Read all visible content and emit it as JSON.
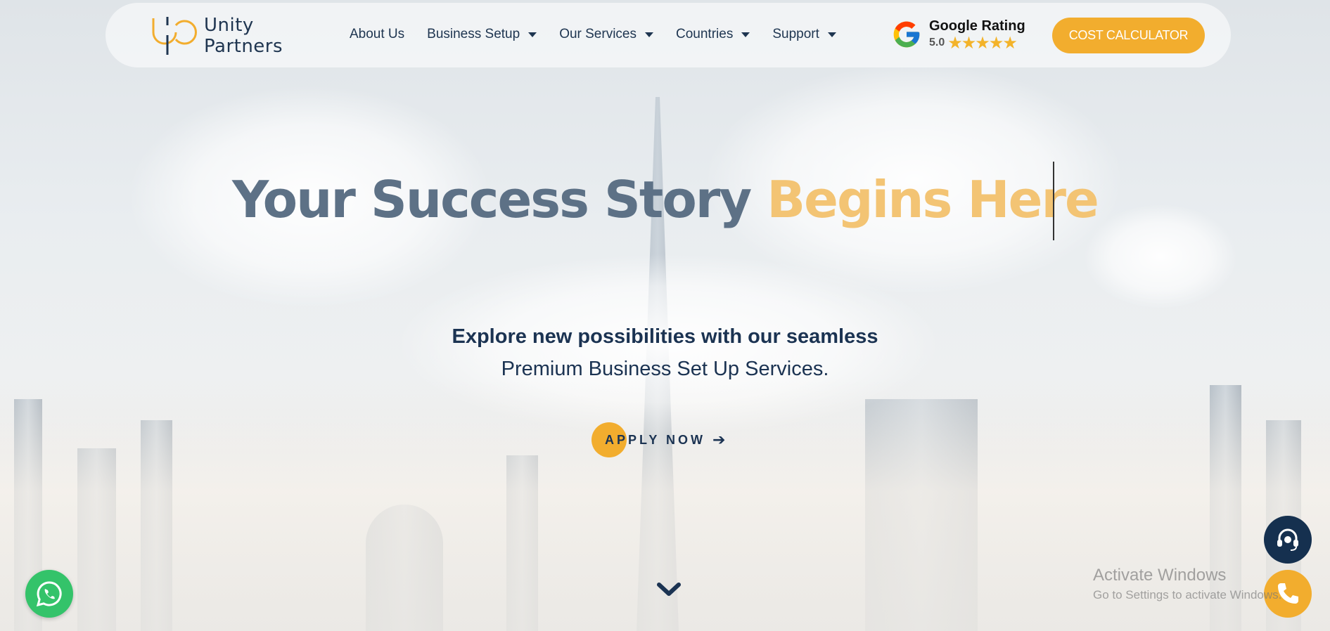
{
  "brand": {
    "logo_line1": "Unity",
    "logo_line2": "Partners",
    "accent_color": "#f2ad2e",
    "navy_color": "#1b3352"
  },
  "nav": {
    "items": [
      {
        "label": "About Us",
        "has_dropdown": false
      },
      {
        "label": "Business Setup",
        "has_dropdown": true
      },
      {
        "label": "Our Services",
        "has_dropdown": true
      },
      {
        "label": "Countries",
        "has_dropdown": true
      },
      {
        "label": "Support",
        "has_dropdown": true
      }
    ]
  },
  "rating": {
    "title": "Google Rating",
    "score": "5.0",
    "stars": "★★★★★",
    "stars_count": 5
  },
  "header": {
    "cta_label": "COST CALCULATOR"
  },
  "hero": {
    "title_part1": "Your Success Story ",
    "title_part2": "Begins Here",
    "subtitle_line1": "Explore new possibilities with our seamless",
    "subtitle_line2": "Premium Business Set Up Services.",
    "apply_label": "APPLY NOW",
    "apply_arrow": "➔"
  },
  "icons": {
    "scroll_down": "chevron-down-icon",
    "whatsapp": "whatsapp-icon",
    "support": "headset-icon",
    "phone": "phone-icon",
    "google": "google-icon"
  },
  "system": {
    "activate_title": "Activate Windows",
    "activate_sub": "Go to Settings to activate Windows."
  }
}
